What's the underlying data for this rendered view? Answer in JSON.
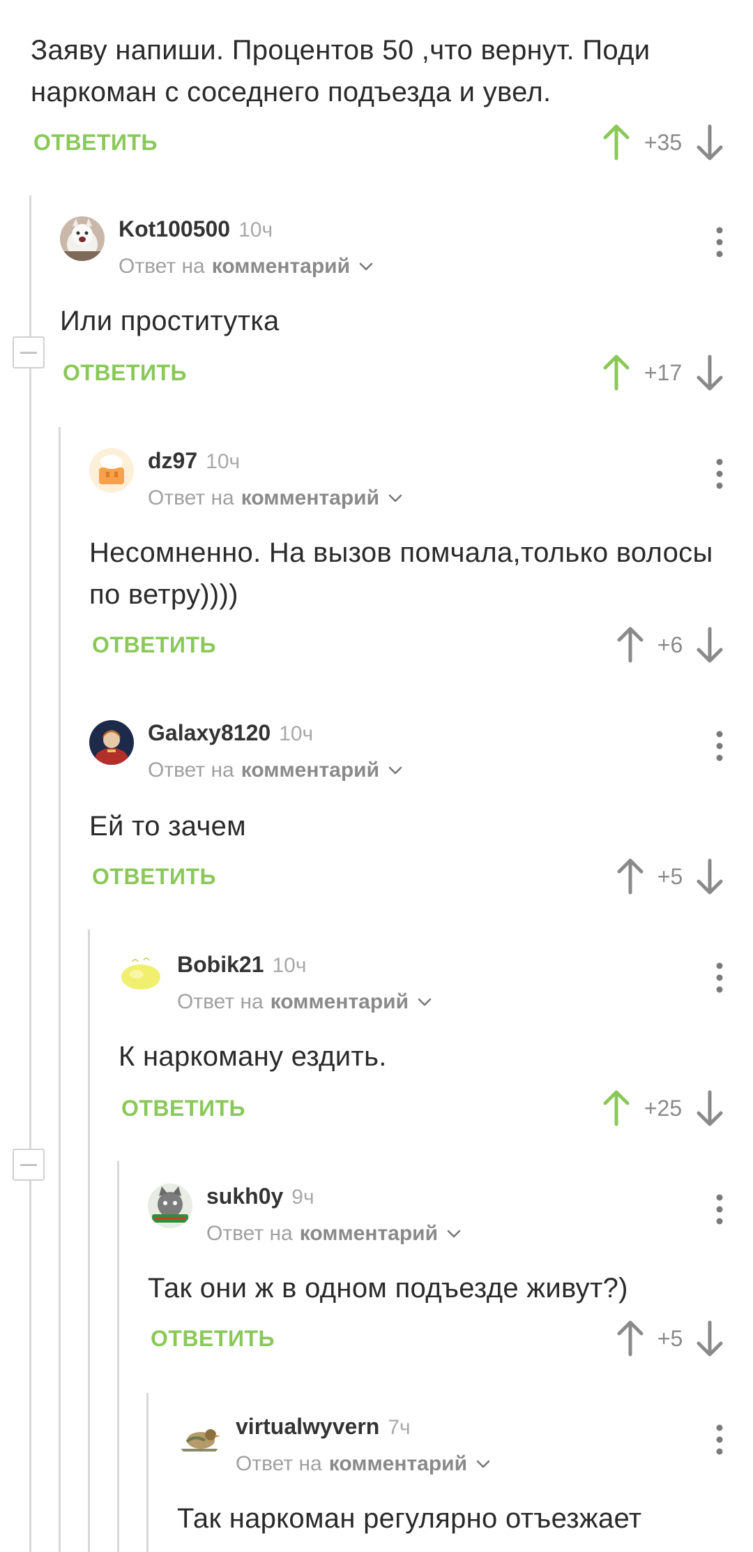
{
  "colors": {
    "accent_green": "#8ac858",
    "up_active": "#8ac858",
    "arrow_inactive": "#8a8a8a",
    "thread_line": "#d8d8d8"
  },
  "reply_to_prefix": "Ответ на",
  "reply_to_link": "комментарий",
  "reply_label": "ОТВЕТИТЬ",
  "comments": [
    {
      "username": "",
      "time": "",
      "text": "Заяву напиши. Процентов 50 ,что вернут.  Поди наркоман с соседнего подъезда и увел.",
      "rating": "+35",
      "voted_up": true
    },
    {
      "username": "Kot100500",
      "time": "10ч",
      "text": "Или проститутка",
      "rating": "+17",
      "voted_up": true,
      "avatar_icon": "white-dog-avatar"
    },
    {
      "username": "dz97",
      "time": "10ч",
      "text": "Несомненно. На вызов помчала,только волосы по ветру))))",
      "rating": "+6",
      "voted_up": false,
      "avatar_icon": "cake-avatar"
    },
    {
      "username": "Galaxy8120",
      "time": "10ч",
      "text": "Ей то зачем",
      "rating": "+5",
      "voted_up": false,
      "avatar_icon": "portrait-avatar"
    },
    {
      "username": "Bobik21",
      "time": "10ч",
      "text": "К наркоману ездить.",
      "rating": "+25",
      "voted_up": true,
      "avatar_icon": "yellow-blob-avatar"
    },
    {
      "username": "sukh0y",
      "time": "9ч",
      "text": "Так они ж в одном подъезде живут?)",
      "rating": "+5",
      "voted_up": false,
      "avatar_icon": "cat-avatar"
    },
    {
      "username": "virtualwyvern",
      "time": "7ч",
      "text": "Так наркоман регулярно отъезжает",
      "rating": "",
      "voted_up": false,
      "avatar_icon": "bird-avatar"
    }
  ]
}
